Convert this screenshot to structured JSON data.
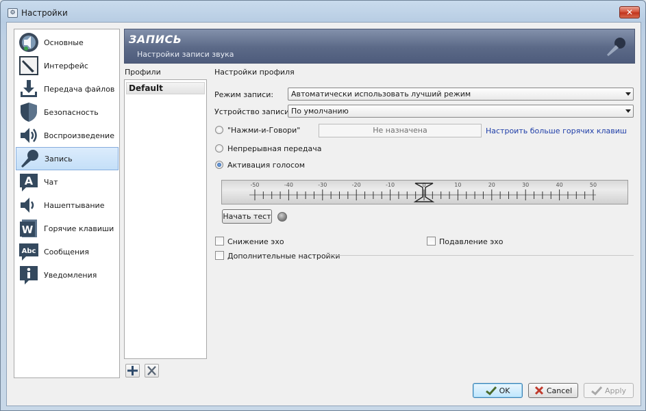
{
  "window": {
    "title": "Настройки"
  },
  "sidebar": {
    "items": [
      {
        "label": "Основные",
        "icon": "speaker-logo-icon"
      },
      {
        "label": "Интерфейс",
        "icon": "pen-icon"
      },
      {
        "label": "Передача файлов",
        "icon": "download-icon"
      },
      {
        "label": "Безопасность",
        "icon": "shield-icon"
      },
      {
        "label": "Воспроизведение",
        "icon": "speaker-icon"
      },
      {
        "label": "Запись",
        "icon": "microphone-icon",
        "selected": true
      },
      {
        "label": "Чат",
        "icon": "chat-a-icon"
      },
      {
        "label": "Нашептывание",
        "icon": "whisper-speaker-icon"
      },
      {
        "label": "Горячие клавиши",
        "icon": "hotkey-w-icon"
      },
      {
        "label": "Сообщения",
        "icon": "abc-messages-icon"
      },
      {
        "label": "Уведомления",
        "icon": "info-icon"
      }
    ]
  },
  "header": {
    "title": "ЗАПИСЬ",
    "subtitle": "Настройки записи звука"
  },
  "profiles": {
    "label": "Профили",
    "items": [
      "Default"
    ]
  },
  "profile_settings": {
    "label": "Настройки профиля",
    "record_mode_label": "Режим записи:",
    "record_mode_value": "Автоматически использовать лучший режим",
    "device_label": "Устройство записи:",
    "device_value": "По умолчанию",
    "ptt_label": "\"Нажми-и-Говори\"",
    "hotkey_value": "Не назначена",
    "more_hotkeys_link": "Настроить больше горячих клавиш",
    "continuous_label": "Непрерывная передача",
    "voice_activation_label": "Активация голосом",
    "selected_mode": "voice_activation",
    "meter_ticks": [
      "-50",
      "-40",
      "-30",
      "-20",
      "-10",
      "0",
      "10",
      "20",
      "30",
      "40",
      "50"
    ],
    "meter_value": 0,
    "test_button": "Начать тест",
    "echo_reduction_label": "Снижение эхо",
    "echo_cancellation_label": "Подавление эхо",
    "advanced_label": "Дополнительные настройки"
  },
  "buttons": {
    "ok": "OK",
    "cancel": "Cancel",
    "apply": "Apply"
  },
  "colors": {
    "banner": "#5b6987",
    "link": "#1f3ea8",
    "selection": "#c4dff8"
  }
}
